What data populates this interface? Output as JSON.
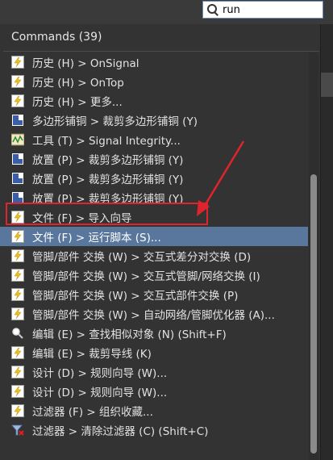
{
  "search": {
    "value": "run"
  },
  "header": {
    "title": "Commands (39)"
  },
  "commands": [
    {
      "icon": "bolt-icon",
      "label": "历史 (H) > OnSignal"
    },
    {
      "icon": "bolt-icon",
      "label": "历史 (H) > OnTop"
    },
    {
      "icon": "bolt-icon",
      "label": "历史 (H) > 更多..."
    },
    {
      "icon": "polygon-pour-icon",
      "label": "多边形铺铜 > 裁剪多边形铺铜 (Y)"
    },
    {
      "icon": "tool-icon",
      "label": "工具 (T) > Signal Integrity..."
    },
    {
      "icon": "polygon-pour-icon",
      "label": "放置 (P) > 裁剪多边形铺铜 (Y)"
    },
    {
      "icon": "polygon-pour-icon",
      "label": "放置 (P) > 裁剪多边形铺铜 (Y)"
    },
    {
      "icon": "polygon-pour-icon",
      "label": "放置 (P) > 裁剪多边形铺铜 (Y)"
    },
    {
      "icon": "bolt-icon",
      "label": "文件 (F) > 导入向导"
    },
    {
      "icon": "bolt-icon",
      "label": "文件 (F) > 运行脚本 (S)...",
      "selected": true
    },
    {
      "icon": "bolt-icon",
      "label": "管脚/部件 交换 (W) > 交互式差分对交换 (D)"
    },
    {
      "icon": "bolt-icon",
      "label": "管脚/部件 交换 (W) > 交互式管脚/网络交换 (I)"
    },
    {
      "icon": "bolt-icon",
      "label": "管脚/部件 交换 (W) > 交互式部件交换 (P)"
    },
    {
      "icon": "bolt-icon",
      "label": "管脚/部件 交换 (W) > 自动网络/管脚优化器 (A)..."
    },
    {
      "icon": "find-similar-icon",
      "label": "编辑 (E) > 查找相似对象 (N) (Shift+F)"
    },
    {
      "icon": "bolt-icon",
      "label": "编辑 (E) > 裁剪导线 (K)"
    },
    {
      "icon": "bolt-icon",
      "label": "设计 (D) > 规则向导 (W)..."
    },
    {
      "icon": "bolt-icon",
      "label": "设计 (D) > 规则向导 (W)..."
    },
    {
      "icon": "bolt-icon",
      "label": "过滤器 (F) > 组织收藏..."
    },
    {
      "icon": "clear-filter-icon",
      "label": "过滤器 > 清除过滤器 (C) (Shift+C)"
    }
  ],
  "colors": {
    "selection": "#59779c",
    "highlight": "#e0242c",
    "panel": "#333333"
  }
}
